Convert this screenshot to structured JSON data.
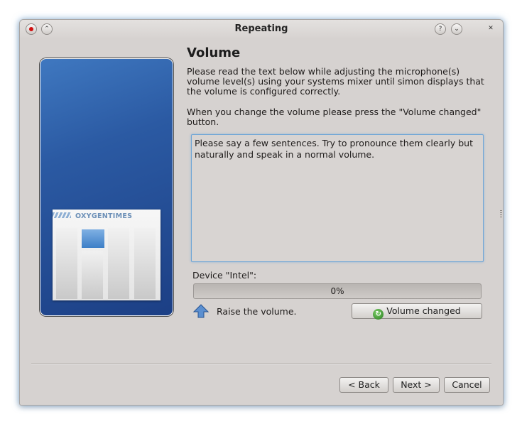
{
  "window": {
    "title": "Repeating"
  },
  "titlebar": {
    "help_label": "?",
    "shade_label": "⌄",
    "close_label": "✕",
    "keep_above_label": "⌃"
  },
  "side_panel": {
    "logo_text": "OXYGENTIMES"
  },
  "page": {
    "heading": "Volume",
    "instructions": "Please read the text below while adjusting the microphone(s) volume level(s) using your systems mixer until simon displays that the volume is configured correctly.",
    "volume_changed_hint": "When you change the volume please press the \"Volume changed\" button.",
    "sample_text": "Please say a few sentences. Try to pronounce them clearly but naturally and speak in a normal volume.",
    "device_label": "Device \"Intel\":",
    "level_text": "0%",
    "level_value": 0,
    "advice_text": "Raise the volume.",
    "volume_changed_button": "Volume changed"
  },
  "buttons": {
    "back": "< Back",
    "next": "Next >",
    "cancel": "Cancel"
  },
  "colors": {
    "accent": "#6fa6d6",
    "panel_blue": "#2b5aa3",
    "window_bg": "#d6d2d0"
  }
}
